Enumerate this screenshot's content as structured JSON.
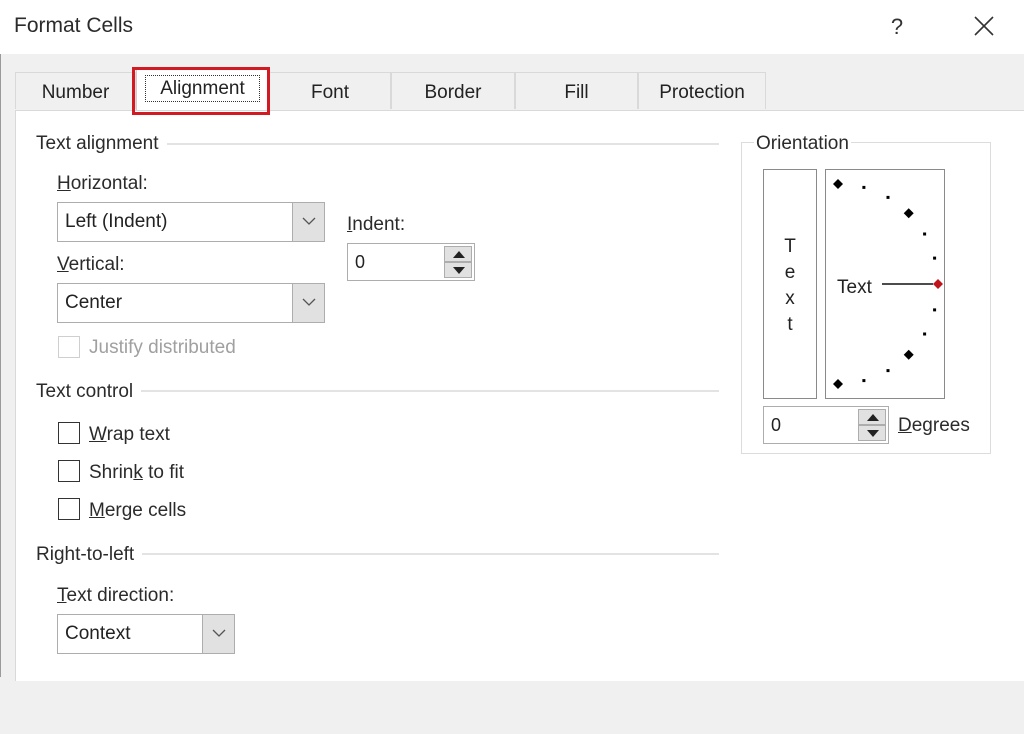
{
  "window": {
    "title": "Format Cells",
    "help_label": "?",
    "close_icon": "close-icon"
  },
  "tabs": [
    {
      "label": "Number",
      "active": false
    },
    {
      "label": "Alignment",
      "active": true
    },
    {
      "label": "Font",
      "active": false
    },
    {
      "label": "Border",
      "active": false
    },
    {
      "label": "Fill",
      "active": false
    },
    {
      "label": "Protection",
      "active": false
    }
  ],
  "highlight_color": "#d11a22",
  "text_alignment": {
    "group_label": "Text alignment",
    "horizontal": {
      "label_mnemonic": "H",
      "label_rest": "orizontal:",
      "value": "Left (Indent)"
    },
    "vertical": {
      "label_mnemonic": "V",
      "label_rest": "ertical:",
      "value": "Center"
    },
    "indent": {
      "label_mnemonic": "I",
      "label_rest": "ndent:",
      "value": "0"
    },
    "justify_distributed": {
      "label": "Justify distributed",
      "checked": false,
      "disabled": true
    }
  },
  "text_control": {
    "group_label": "Text control",
    "wrap_text": {
      "pre": "",
      "mnemonic": "W",
      "post": "rap text",
      "checked": false
    },
    "shrink_to_fit": {
      "pre": "Shrin",
      "mnemonic": "k",
      "post": " to fit",
      "checked": false
    },
    "merge_cells": {
      "pre": "",
      "mnemonic": "M",
      "post": "erge cells",
      "checked": false
    }
  },
  "right_to_left": {
    "group_label": "Right-to-left",
    "text_direction": {
      "label_mnemonic": "T",
      "label_rest": "ext direction:",
      "value": "Context"
    }
  },
  "orientation": {
    "group_label": "Orientation",
    "vertical_text_letters": [
      "T",
      "e",
      "x",
      "t"
    ],
    "dial_text": "Text",
    "degrees_value": "0",
    "degrees_label_mnemonic": "D",
    "degrees_label_rest": "egrees",
    "selected_marker_color": "#c0141c",
    "current_angle_deg": 0
  }
}
